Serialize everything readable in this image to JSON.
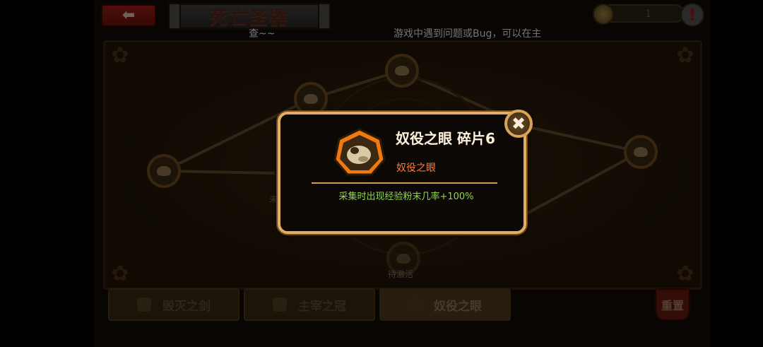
{
  "header": {
    "back_icon": "left-arrow-icon",
    "title": "死亡圣器",
    "counter_value": "1",
    "alert_symbol": "!"
  },
  "ticker": {
    "left_text": "查~~",
    "right_text": "游戏中遇到问题或Bug，可以在主"
  },
  "board": {
    "node_captions": [
      "未",
      "待激活"
    ]
  },
  "tabs": [
    {
      "label": "毁灭之剑",
      "active": false
    },
    {
      "label": "主宰之冠",
      "active": false
    },
    {
      "label": "奴役之眼",
      "active": true
    }
  ],
  "reset_label": "重置",
  "popup": {
    "title": "奴役之眼 碎片6",
    "subtitle": "奴役之眼",
    "effect": "采集时出现经验粉末几率+100%",
    "close_symbol": "✖"
  },
  "colors": {
    "popup_border": "#e4ad66",
    "subtitle": "#ff7f36",
    "effect": "#8fd84a"
  }
}
